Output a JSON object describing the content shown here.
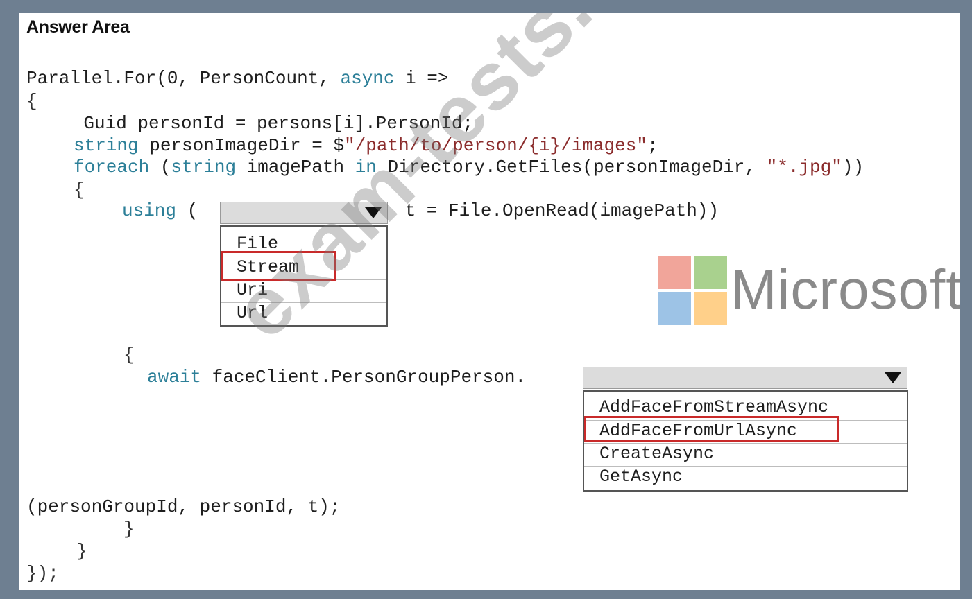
{
  "heading": "Answer Area",
  "code": {
    "l1_a": "Parallel.For(0, PersonCount, ",
    "l1_kw": "async",
    "l1_b": " i =>",
    "l2": "{",
    "l3": "    Guid personId = persons[i].PersonId;",
    "l4_kw": "string",
    "l4_a": " personImageDir = $",
    "l4_str": "\"/path/to/person/{i}/images\"",
    "l4_b": ";",
    "l5_kw1": "foreach",
    "l5_a": " (",
    "l5_kw2": "string",
    "l5_b": " imagePath ",
    "l5_kw3": "in",
    "l5_c": " Directory.GetFiles(personImageDir, ",
    "l5_str": "\"*.jpg\"",
    "l5_d": "))",
    "l6": "{",
    "l7_kw": "using",
    "l7_a": " (",
    "l7_b": " t = File.OpenRead(imagePath))",
    "l8": "{",
    "l9_kw": "await",
    "l9_a": " faceClient.PersonGroupPerson.",
    "l10": "(personGroupId, personId, t);",
    "l11": "}",
    "l12": "}",
    "l13": "});"
  },
  "dropdown1": {
    "selected": "",
    "options": [
      "File",
      "Stream",
      "Uri",
      "Url"
    ],
    "highlighted": "Stream"
  },
  "dropdown2": {
    "selected": "",
    "options": [
      "AddFaceFromStreamAsync",
      "AddFaceFromUrlAsync",
      "CreateAsync",
      "GetAsync"
    ],
    "highlighted": "AddFaceFromUrlAsync"
  },
  "logo": {
    "text": "Microsoft",
    "colors": [
      "#f1a59a",
      "#a9d18e",
      "#9dc3e6",
      "#ffd08a"
    ]
  },
  "watermark": "exam-tests.com",
  "colors": {
    "keyword": "#2c7f98",
    "highlight_border": "#c92a2a",
    "frame": "#6e7f91"
  }
}
